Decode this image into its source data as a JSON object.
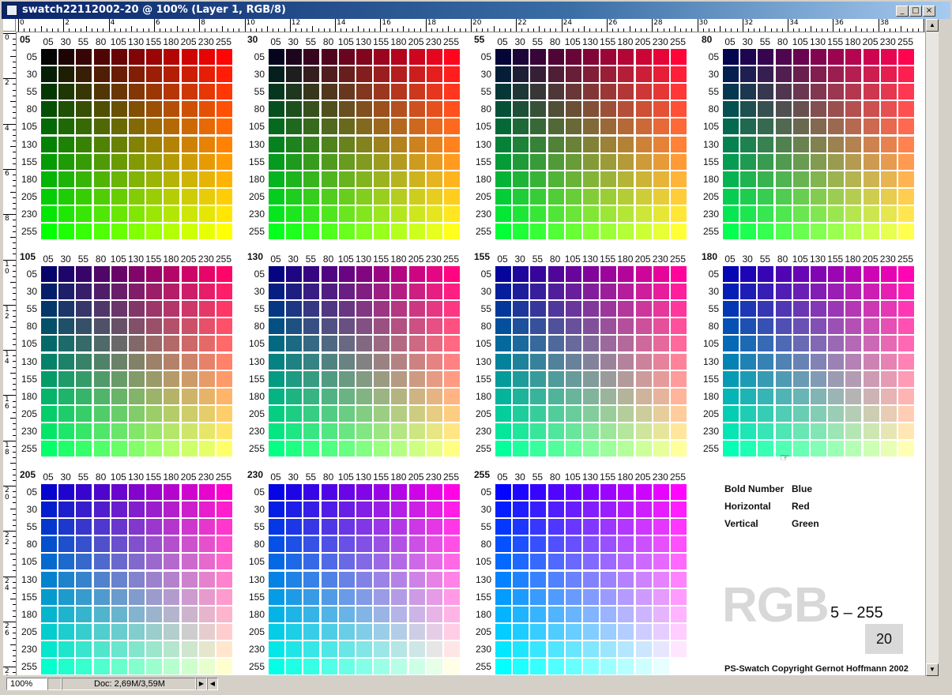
{
  "window": {
    "title": "swatch22112002-20 @ 100% (Layer 1, RGB/8)",
    "buttons": {
      "minimize": "_",
      "maximize": "□",
      "close": "×"
    }
  },
  "ruler": {
    "top_labels": [
      "0",
      "2",
      "4",
      "6",
      "8",
      "10",
      "12",
      "14",
      "16",
      "18",
      "20",
      "22",
      "24",
      "26",
      "28",
      "30",
      "32",
      "34",
      "36",
      "38",
      "40"
    ],
    "left_labels": [
      "0",
      "2",
      "4",
      "6",
      "8",
      "10",
      "12",
      "14",
      "16",
      "18",
      "20",
      "22",
      "24",
      "26",
      "28"
    ]
  },
  "swatch": {
    "values": [
      "05",
      "30",
      "55",
      "80",
      "105",
      "130",
      "155",
      "180",
      "205",
      "230",
      "255"
    ],
    "panels": [
      {
        "blue": "05"
      },
      {
        "blue": "30"
      },
      {
        "blue": "55"
      },
      {
        "blue": "80"
      },
      {
        "blue": "105"
      },
      {
        "blue": "130"
      },
      {
        "blue": "155"
      },
      {
        "blue": "180"
      },
      {
        "blue": "205"
      },
      {
        "blue": "230"
      },
      {
        "blue": "255"
      }
    ]
  },
  "legend": {
    "rows": [
      {
        "label": "Bold Number",
        "value": "Blue"
      },
      {
        "label": "Horizontal",
        "value": "Red"
      },
      {
        "label": "Vertical",
        "value": "Green"
      }
    ]
  },
  "branding": {
    "model": "RGB",
    "range": "5 – 255",
    "step": "20",
    "copyright": "PS-Swatch Copyright Gernot Hoffmann 2002"
  },
  "status": {
    "zoom": "100%",
    "doc": "Doc: 2,69M/3,59M"
  }
}
